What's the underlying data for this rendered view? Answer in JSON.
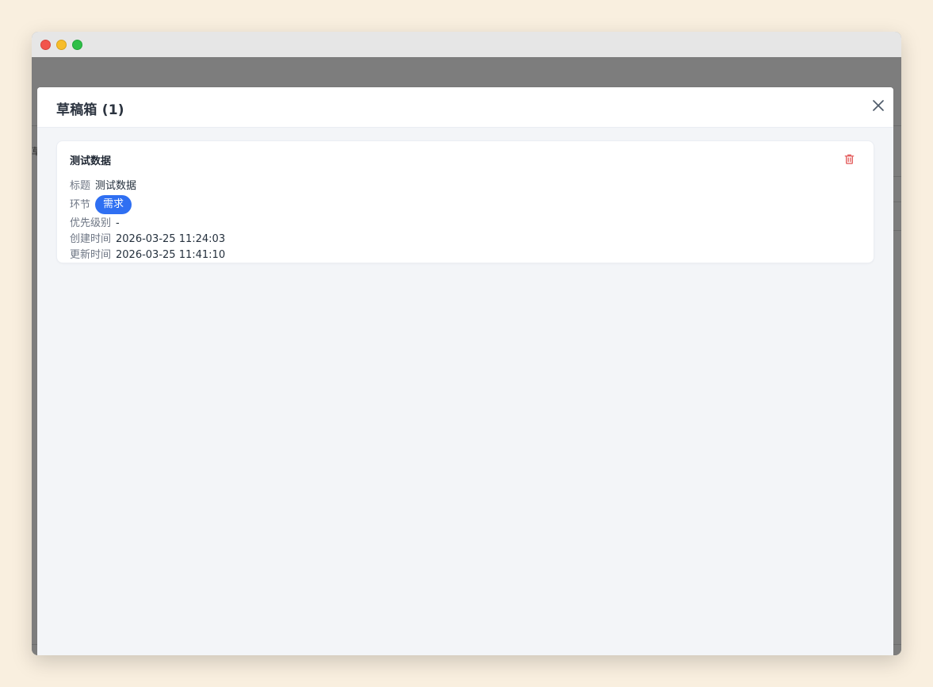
{
  "window": {
    "traffic_lights": [
      "close",
      "minimize",
      "maximize"
    ]
  },
  "background": {
    "partial_glyph": "草"
  },
  "modal": {
    "title": "草稿箱 (1)",
    "close_icon": "close-icon"
  },
  "draft_card": {
    "title": "测试数据",
    "delete_icon": "trash-icon",
    "fields": {
      "title_label": "标题",
      "title_value": "测试数据",
      "stage_label": "环节",
      "stage_tag": "需求",
      "priority_label": "优先级别",
      "priority_value": "-",
      "created_label": "创建时间",
      "created_value": "2026-03-25 11:24:03",
      "updated_label": "更新时间",
      "updated_value": "2026-03-25 11:41:10"
    }
  },
  "colors": {
    "page_bg": "#f9efdf",
    "modal_body_bg": "#f3f5f8",
    "tag_bg": "#2f6ff2",
    "delete_icon": "#e25555"
  }
}
